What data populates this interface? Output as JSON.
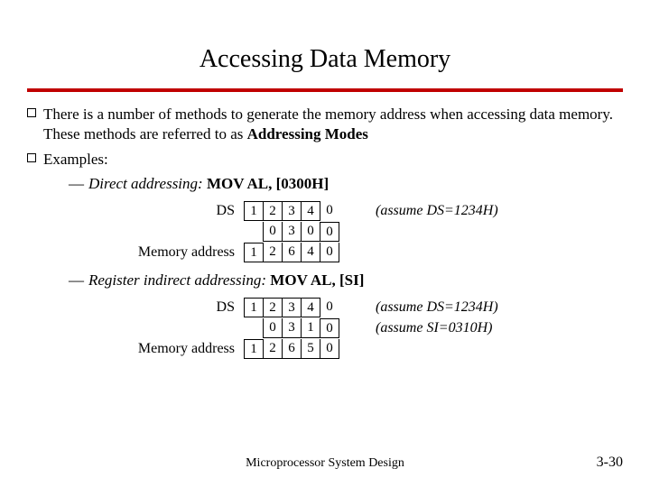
{
  "title": "Accessing Data Memory",
  "bullet1_a": "There is a number of methods to generate the memory address when accessing data memory. These methods are referred to as ",
  "bullet1_b": "Addressing Modes",
  "bullet2": "Examples:",
  "ex1_label": "Direct addressing:",
  "ex1_code": "MOV AL, [0300H]",
  "ex2_label": "Register indirect addressing:",
  "ex2_code": "MOV AL, [SI]",
  "labels": {
    "ds": "DS",
    "mem": "Memory address"
  },
  "t1": {
    "r1": [
      "1",
      "2",
      "3",
      "4",
      "0"
    ],
    "r2": [
      "",
      "0",
      "3",
      "0",
      "0"
    ],
    "r3": [
      "1",
      "2",
      "6",
      "4",
      "0"
    ]
  },
  "t2": {
    "r1": [
      "1",
      "2",
      "3",
      "4",
      "0"
    ],
    "r2": [
      "",
      "0",
      "3",
      "1",
      "0"
    ],
    "r3": [
      "1",
      "2",
      "6",
      "5",
      "0"
    ]
  },
  "assume_ds": "(assume DS=1234H)",
  "assume_si": "(assume SI=0310H)",
  "footer": "Microprocessor System Design",
  "page": "3-30"
}
